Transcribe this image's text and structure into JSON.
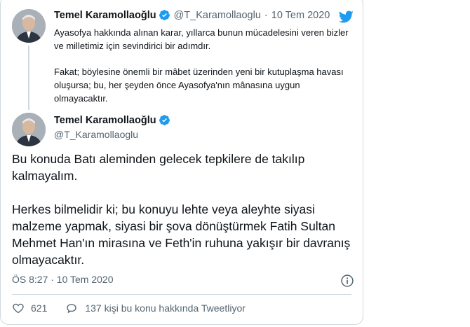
{
  "parent_tweet": {
    "display_name": "Temel Karamollaoğlu",
    "handle": "@T_Karamollaoglu",
    "separator": "·",
    "date": "10 Tem 2020",
    "paragraphs": [
      "Ayasofya hakkında alınan karar, yıllarca bunun mücadelesini veren bizler ve milletimiz için sevindirici bir adımdır.",
      "Fakat; böylesine önemli bir mâbet üzerinden yeni bir kutuplaşma havası oluşursa; bu, her şeyden önce Ayasofya'nın mânasına uygun olmayacaktır."
    ]
  },
  "main_tweet": {
    "display_name": "Temel Karamollaoğlu",
    "handle": "@T_Karamollaoglu",
    "paragraphs": [
      "Bu konuda Batı aleminden gelecek tepkilere de takılıp kalmayalım.",
      "Herkes bilmelidir ki; bu konuyu lehte veya aleyhte siyasi malzeme yapmak, siyasi bir şova dönüştürmek Fatih Sultan Mehmet Han'ın mirasına ve Feth'in ruhuna yakışır bir davranış olmayacaktır."
    ],
    "timestamp": "ÖS 8:27 · 10 Tem 2020",
    "like_count": "621",
    "talking_label": "137 kişi bu konu hakkında Tweetliyor"
  },
  "icons": {
    "verified": "verified-badge-icon",
    "brand": "twitter-bird-icon",
    "info": "info-icon",
    "like": "heart-icon",
    "reply": "speech-bubble-icon"
  },
  "colors": {
    "brand_blue": "#1d9bf0",
    "text": "#0f1419",
    "muted": "#536471",
    "border": "#cfd9de"
  }
}
